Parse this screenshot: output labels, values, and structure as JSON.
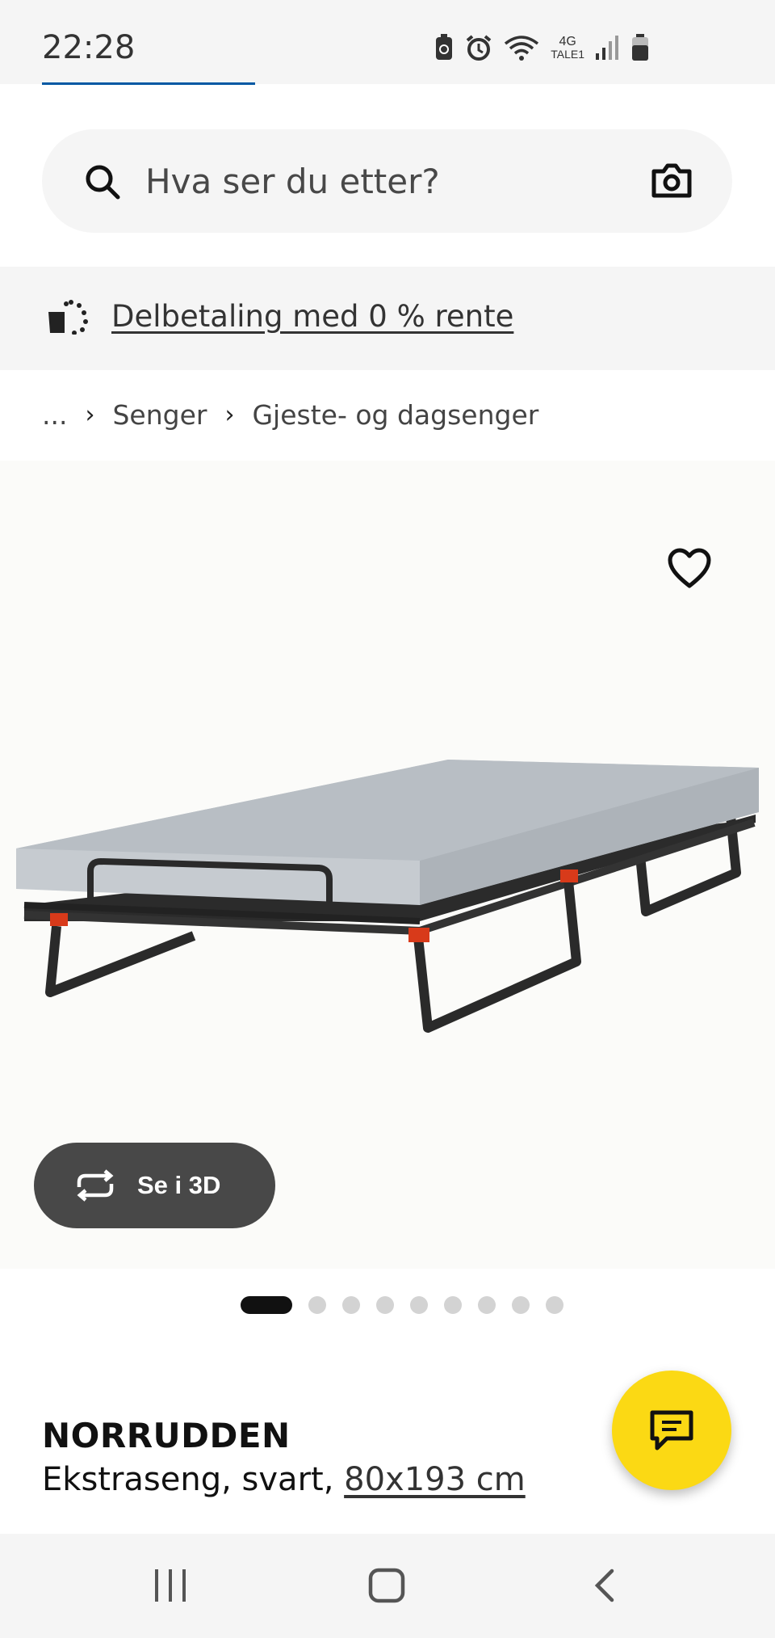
{
  "status_bar": {
    "time": "22:28",
    "network_label": "4G",
    "carrier_label": "TALE1",
    "icons": [
      "battery-saver-icon",
      "alarm-icon",
      "wifi-icon",
      "signal-icon",
      "battery-icon"
    ]
  },
  "search": {
    "placeholder": "Hva ser du etter?",
    "value": ""
  },
  "banner": {
    "link_text": "Delbetaling med 0 % rente"
  },
  "breadcrumb": {
    "ellipsis": "...",
    "items": [
      "Senger",
      "Gjeste- og dagsenger"
    ]
  },
  "product_image": {
    "view_3d_label": "Se i 3D",
    "image_count": 9,
    "active_index": 0
  },
  "product": {
    "name": "NORRUDDEN",
    "description": "Ekstraseng, svart, ",
    "size": "80x193 cm"
  },
  "colors": {
    "accent_yellow": "#fbd914",
    "brand_blue": "#0058a3",
    "dark_button": "#484848"
  }
}
